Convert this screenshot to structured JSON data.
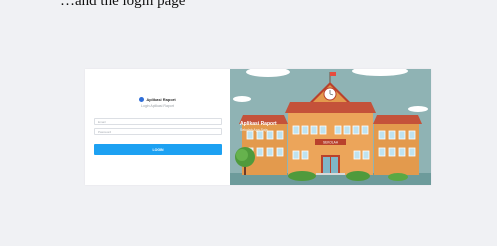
{
  "caption": "…and the login page",
  "login": {
    "brand": "Aplikasi Raport",
    "subtitle": "Login Aplikasi Raport",
    "username_placeholder": "Email",
    "password_placeholder": "Password",
    "button_label": "LOGIN"
  },
  "hero": {
    "title": "Aplikasi Raport",
    "subtitle": "Sekolah Apa Saja",
    "school_sign": "SEKOLAH"
  },
  "colors": {
    "page_bg": "#f0f1f4",
    "accent": "#1da1f2",
    "illustration_bg": "#8fb3b4",
    "roof": "#c4523a",
    "wall": "#e39a4d"
  },
  "icons": [
    "app-logo-icon",
    "school-building-icon",
    "clock-icon",
    "flag-icon",
    "tree-icon",
    "cloud-icon"
  ]
}
